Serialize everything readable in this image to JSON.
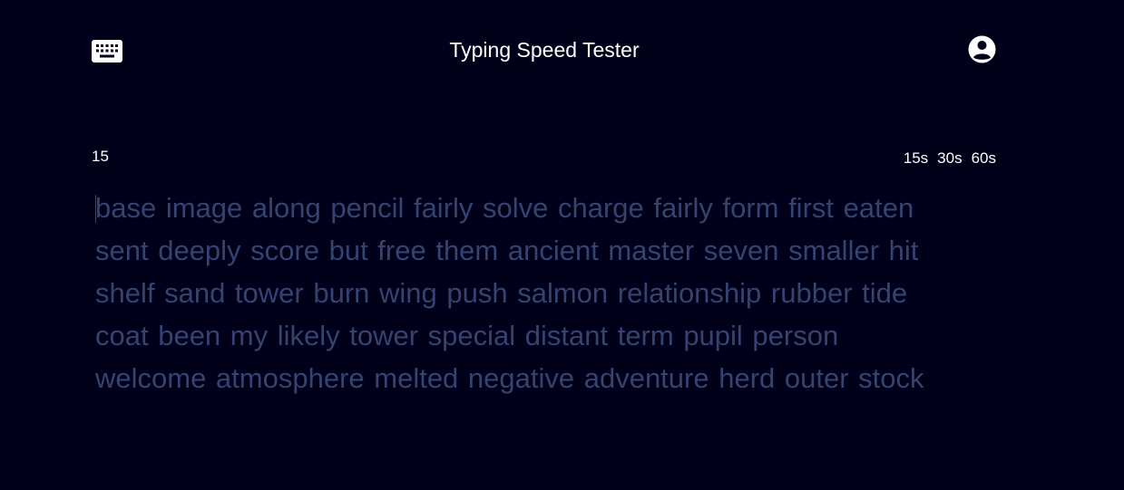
{
  "header": {
    "title": "Typing Speed Tester",
    "logo_icon": "keyboard-icon",
    "account_icon": "account-circle-icon"
  },
  "test": {
    "timer": "15",
    "modes": [
      "15s",
      "30s",
      "60s"
    ]
  },
  "words": {
    "lines": [
      "base image along pencil fairly solve charge fairly form first eaten",
      "sent deeply score but free them ancient master seven smaller hit",
      "shelf sand tower burn wing push salmon relationship rubber tide",
      "coat been my likely tower special distant term pupil person",
      "welcome atmosphere melted negative adventure herd outer stock"
    ]
  },
  "colors": {
    "background": "#00001a",
    "text": "#ffffff",
    "pending_word": "#34436f"
  }
}
